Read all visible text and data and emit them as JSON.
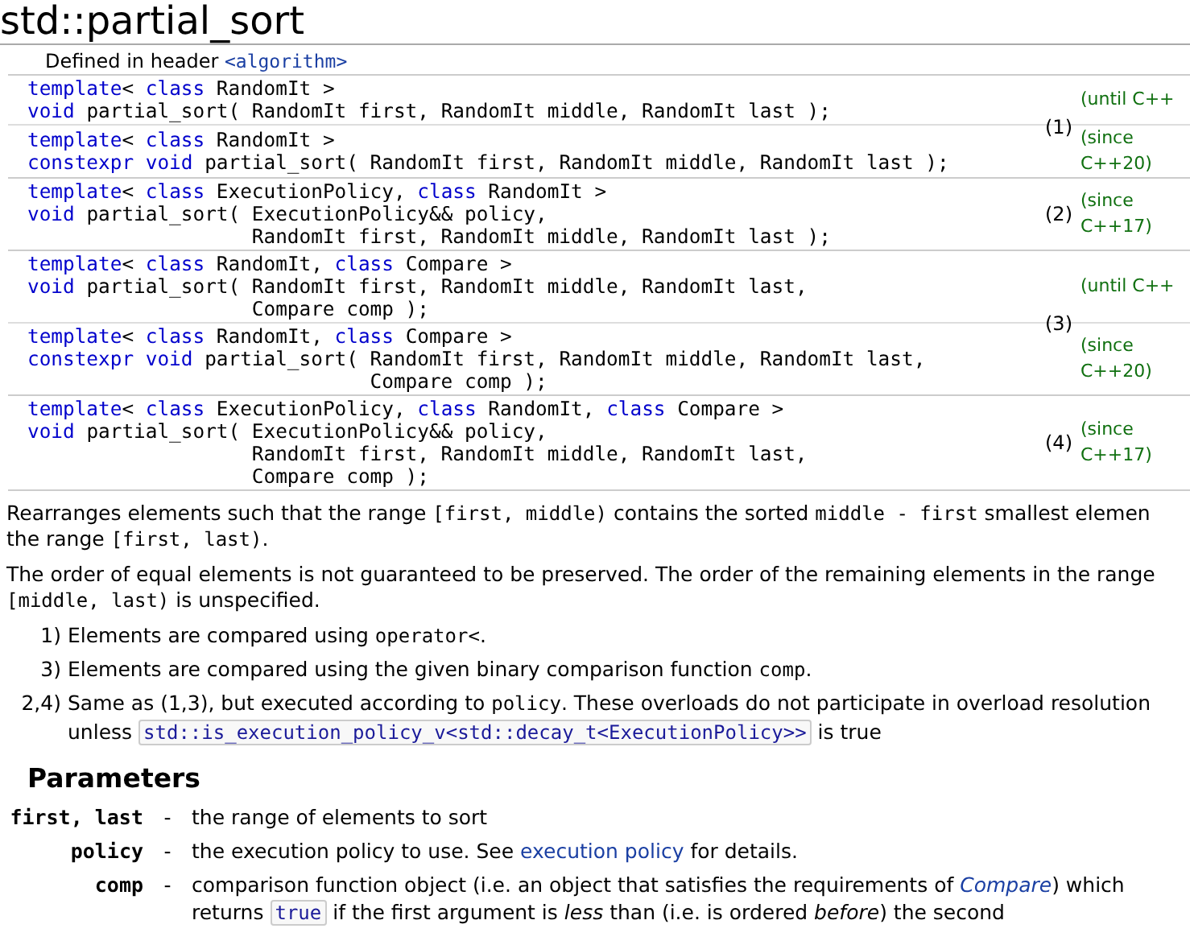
{
  "title": "std::partial_sort",
  "header_note": {
    "label": "Defined in header",
    "header": "<algorithm>"
  },
  "overloads": [
    {
      "number": "(1)",
      "variants": [
        {
          "version": [
            "(until C++"
          ],
          "lines": [
            [
              {
                "kind": "kw",
                "text": "template"
              },
              {
                "kind": "p",
                "text": "< "
              },
              {
                "kind": "kw",
                "text": "class"
              },
              {
                "kind": "p",
                "text": " RandomIt >"
              }
            ],
            [
              {
                "kind": "kw",
                "text": "void"
              },
              {
                "kind": "p",
                "text": " partial_sort( RandomIt first, RandomIt middle, RandomIt last );"
              }
            ]
          ]
        },
        {
          "version": [
            "(since",
            "C++20)"
          ],
          "lines": [
            [
              {
                "kind": "kw",
                "text": "template"
              },
              {
                "kind": "p",
                "text": "< "
              },
              {
                "kind": "kw",
                "text": "class"
              },
              {
                "kind": "p",
                "text": " RandomIt >"
              }
            ],
            [
              {
                "kind": "kw",
                "text": "constexpr void"
              },
              {
                "kind": "p",
                "text": " partial_sort( RandomIt first, RandomIt middle, RandomIt last );"
              }
            ]
          ]
        }
      ]
    },
    {
      "number": "(2)",
      "variants": [
        {
          "version": [
            "(since",
            "C++17)"
          ],
          "lines": [
            [
              {
                "kind": "kw",
                "text": "template"
              },
              {
                "kind": "p",
                "text": "< "
              },
              {
                "kind": "kw",
                "text": "class"
              },
              {
                "kind": "p",
                "text": " ExecutionPolicy, "
              },
              {
                "kind": "kw",
                "text": "class"
              },
              {
                "kind": "p",
                "text": " RandomIt >"
              }
            ],
            [
              {
                "kind": "kw",
                "text": "void"
              },
              {
                "kind": "p",
                "text": " partial_sort( ExecutionPolicy&& policy,"
              }
            ],
            [
              {
                "kind": "p",
                "text": "                   RandomIt first, RandomIt middle, RandomIt last );"
              }
            ]
          ]
        }
      ]
    },
    {
      "number": "(3)",
      "variants": [
        {
          "version": [
            "(until C++"
          ],
          "lines": [
            [
              {
                "kind": "kw",
                "text": "template"
              },
              {
                "kind": "p",
                "text": "< "
              },
              {
                "kind": "kw",
                "text": "class"
              },
              {
                "kind": "p",
                "text": " RandomIt, "
              },
              {
                "kind": "kw",
                "text": "class"
              },
              {
                "kind": "p",
                "text": " Compare >"
              }
            ],
            [
              {
                "kind": "kw",
                "text": "void"
              },
              {
                "kind": "p",
                "text": " partial_sort( RandomIt first, RandomIt middle, RandomIt last,"
              }
            ],
            [
              {
                "kind": "p",
                "text": "                   Compare comp );"
              }
            ]
          ]
        },
        {
          "version": [
            "(since",
            "C++20)"
          ],
          "lines": [
            [
              {
                "kind": "kw",
                "text": "template"
              },
              {
                "kind": "p",
                "text": "< "
              },
              {
                "kind": "kw",
                "text": "class"
              },
              {
                "kind": "p",
                "text": " RandomIt, "
              },
              {
                "kind": "kw",
                "text": "class"
              },
              {
                "kind": "p",
                "text": " Compare >"
              }
            ],
            [
              {
                "kind": "kw",
                "text": "constexpr void"
              },
              {
                "kind": "p",
                "text": " partial_sort( RandomIt first, RandomIt middle, RandomIt last,"
              }
            ],
            [
              {
                "kind": "p",
                "text": "                             Compare comp );"
              }
            ]
          ]
        }
      ]
    },
    {
      "number": "(4)",
      "variants": [
        {
          "version": [
            "(since",
            "C++17)"
          ],
          "lines": [
            [
              {
                "kind": "kw",
                "text": "template"
              },
              {
                "kind": "p",
                "text": "< "
              },
              {
                "kind": "kw",
                "text": "class"
              },
              {
                "kind": "p",
                "text": " ExecutionPolicy, "
              },
              {
                "kind": "kw",
                "text": "class"
              },
              {
                "kind": "p",
                "text": " RandomIt, "
              },
              {
                "kind": "kw",
                "text": "class"
              },
              {
                "kind": "p",
                "text": " Compare >"
              }
            ],
            [
              {
                "kind": "kw",
                "text": "void"
              },
              {
                "kind": "p",
                "text": " partial_sort( ExecutionPolicy&& policy,"
              }
            ],
            [
              {
                "kind": "p",
                "text": "                   RandomIt first, RandomIt middle, RandomIt last,"
              }
            ],
            [
              {
                "kind": "p",
                "text": "                   Compare comp );"
              }
            ]
          ]
        }
      ]
    }
  ],
  "paragraphs": [
    [
      [
        {
          "kind": "text",
          "text": "Rearranges elements such that the range "
        },
        {
          "kind": "code",
          "text": "[first, middle)"
        },
        {
          "kind": "text",
          "text": " contains the sorted "
        },
        {
          "kind": "code",
          "text": "middle - first"
        },
        {
          "kind": "text",
          "text": " smallest elemen"
        }
      ],
      [
        {
          "kind": "text",
          "text": "the range "
        },
        {
          "kind": "code",
          "text": "[first, last)"
        },
        {
          "kind": "text",
          "text": "."
        }
      ]
    ],
    [
      [
        {
          "kind": "text",
          "text": "The order of equal elements is not guaranteed to be preserved. The order of the remaining elements in the range"
        }
      ],
      [
        {
          "kind": "code",
          "text": "[middle, last)"
        },
        {
          "kind": "text",
          "text": " is unspecified."
        }
      ]
    ]
  ],
  "notes": [
    {
      "marker": "1)",
      "lines": [
        [
          {
            "kind": "text",
            "text": "Elements are compared using "
          },
          {
            "kind": "code",
            "text": "operator<"
          },
          {
            "kind": "text",
            "text": "."
          }
        ]
      ]
    },
    {
      "marker": "3)",
      "lines": [
        [
          {
            "kind": "text",
            "text": "Elements are compared using the given binary comparison function "
          },
          {
            "kind": "code",
            "text": "comp"
          },
          {
            "kind": "text",
            "text": "."
          }
        ]
      ]
    },
    {
      "marker": "2,4)",
      "lines": [
        [
          {
            "kind": "text",
            "text": "Same as (1,3), but executed according to "
          },
          {
            "kind": "code",
            "text": "policy"
          },
          {
            "kind": "text",
            "text": ". These overloads do not participate in overload resolution"
          }
        ],
        [
          {
            "kind": "text",
            "text": "unless "
          },
          {
            "kind": "codebox",
            "text": "std::is_execution_policy_v<std::decay_t<ExecutionPolicy>>"
          },
          {
            "kind": "text",
            "text": " is true"
          }
        ]
      ]
    }
  ],
  "parameters": {
    "heading": "Parameters",
    "rows": [
      {
        "name": "first, last",
        "dash": "-",
        "lines": [
          [
            {
              "kind": "text",
              "text": "the range of elements to sort"
            }
          ]
        ]
      },
      {
        "name": "policy",
        "dash": "-",
        "lines": [
          [
            {
              "kind": "text",
              "text": "the execution policy to use. See "
            },
            {
              "kind": "link",
              "text": "execution policy"
            },
            {
              "kind": "text",
              "text": " for details."
            }
          ]
        ]
      },
      {
        "name": "comp",
        "dash": "-",
        "lines": [
          [
            {
              "kind": "text",
              "text": "comparison function object (i.e. an object that satisfies the requirements of "
            },
            {
              "kind": "ilink",
              "text": "Compare"
            },
            {
              "kind": "text",
              "text": ") which"
            }
          ],
          [
            {
              "kind": "text",
              "text": "returns "
            },
            {
              "kind": "codebox",
              "text": "true"
            },
            {
              "kind": "text",
              "text": " if the first argument is "
            },
            {
              "kind": "em",
              "text": "less"
            },
            {
              "kind": "text",
              "text": " than (i.e. is ordered "
            },
            {
              "kind": "em",
              "text": "before"
            },
            {
              "kind": "text",
              "text": ") the second"
            }
          ]
        ]
      }
    ]
  }
}
